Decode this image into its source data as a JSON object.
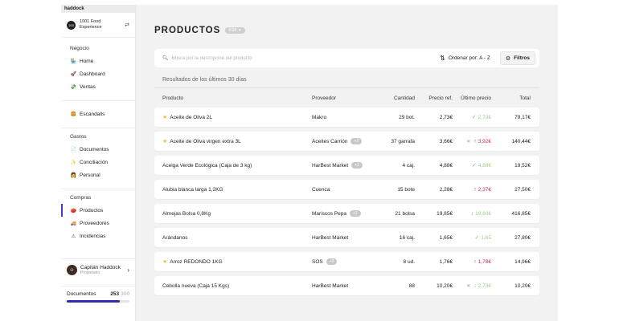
{
  "window_title": "haddock",
  "org": {
    "name_line1": "1001 Food",
    "name_line2": "Experience",
    "logo_text": "100"
  },
  "sidebar": {
    "sections": [
      {
        "title": "Negocio",
        "items": [
          {
            "label": "Home",
            "icon": "shop-icon",
            "glyph": "🏪"
          },
          {
            "label": "Dashboard",
            "icon": "rocket-icon",
            "glyph": "🚀"
          },
          {
            "label": "Ventas",
            "icon": "money-icon",
            "glyph": "💸"
          }
        ]
      },
      {
        "title": "",
        "items": [
          {
            "label": "Escandalls",
            "icon": "burger-icon",
            "glyph": "🍔"
          }
        ]
      },
      {
        "title": "Gastos",
        "items": [
          {
            "label": "Documentos",
            "icon": "document-icon",
            "glyph": "📄"
          },
          {
            "label": "Conciliación",
            "icon": "sparkle-icon",
            "glyph": "✨"
          },
          {
            "label": "Personal",
            "icon": "person-icon",
            "glyph": "👩"
          }
        ]
      },
      {
        "title": "Compras",
        "items": [
          {
            "label": "Productos",
            "icon": "tomato-icon",
            "glyph": "🍅",
            "active": true
          },
          {
            "label": "Proveedores",
            "icon": "truck-icon",
            "glyph": "🚚"
          },
          {
            "label": "Incidencias",
            "icon": "warning-icon",
            "glyph": "⚠"
          }
        ]
      }
    ]
  },
  "user": {
    "name": "Capitán Haddock",
    "role": "Propietario"
  },
  "docs": {
    "label": "Documentos",
    "count": "253",
    "max": "300",
    "progress": 0.843
  },
  "page": {
    "title": "PRODUCTOS",
    "count": "634"
  },
  "search": {
    "placeholder": "Busca por la descripción del producto",
    "sort_label": "Ordenar por: A - Z",
    "filters_label": "Filtros"
  },
  "results_label": "Resultados de los últimos 30 días",
  "table": {
    "headers": {
      "product": "Producto",
      "provider": "Proveedor",
      "qty": "Cantidad",
      "price": "Precio ref.",
      "last": "Último precio",
      "total": "Total"
    },
    "rows": [
      {
        "star": true,
        "product": "Aceite de Oliva 2L",
        "provider": "Makro",
        "extra": "",
        "qty": "29 bot.",
        "price": "2,73€",
        "x": false,
        "trend": "check",
        "last": "2,73€",
        "total": "79,17€"
      },
      {
        "star": true,
        "product": "Aceite de Oliva virgen extra 3L",
        "provider": "Aceites Carrión",
        "extra": "+2",
        "qty": "37 garrafa",
        "price": "3,66€",
        "x": true,
        "trend": "up",
        "last": "3,92€",
        "total": "140,44€"
      },
      {
        "star": false,
        "product": "Acelga Verde Ecológica (Caja de 3 kg)",
        "provider": "HarBest Market",
        "extra": "+1",
        "qty": "4 caj.",
        "price": "4,88€",
        "x": false,
        "trend": "check",
        "last": "4,88€",
        "total": "19,52€"
      },
      {
        "star": false,
        "product": "Alubia blanca larga 1,2KG",
        "provider": "Cuenca",
        "extra": "",
        "qty": "15 bote",
        "price": "2,28€",
        "x": false,
        "trend": "up",
        "last": "2,37€",
        "total": "27,50€"
      },
      {
        "star": false,
        "product": "Almejas Bolsa 0,8Kg",
        "provider": "Mariscos Pepa",
        "extra": "+1",
        "qty": "21 bolsa",
        "price": "19,85€",
        "x": false,
        "trend": "down",
        "last": "19,60€",
        "total": "416,85€"
      },
      {
        "star": false,
        "product": "Arándanos",
        "provider": "HarBest Market",
        "extra": "",
        "qty": "16 caj.",
        "price": "1,65€",
        "x": false,
        "trend": "check",
        "last": "1,65",
        "total": "27,80€"
      },
      {
        "star": true,
        "product": "Arroz REDONDO 1KG",
        "provider": "SOS",
        "extra": "+3",
        "qty": "8 ud.",
        "price": "1,76€",
        "x": false,
        "trend": "up",
        "last": "1,78€",
        "total": "14,96€"
      },
      {
        "star": false,
        "product": "Cebolla nueva (Caja 15 Kgs)",
        "provider": "HarBest Market",
        "extra": "",
        "qty": "88",
        "price": "10,20€",
        "x": true,
        "trend": "down",
        "last": "2,73€",
        "total": "10,20€"
      }
    ]
  },
  "colors": {
    "accent": "#3b3bd6",
    "up": "#e0245e",
    "ok": "#7cc35b"
  }
}
